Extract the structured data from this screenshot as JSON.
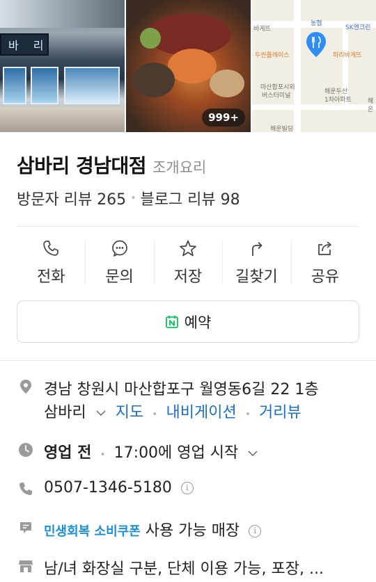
{
  "photos": {
    "count_badge": "999+",
    "storefront_sign": "바 리",
    "map_labels": {
      "l1": "바게뜨",
      "l2": "농협",
      "l3": "SK엔크린",
      "l4": "두씬플레이스",
      "l5": "파리바게뜨",
      "l6": "마산합포시외",
      "l7": "버스터미널",
      "l8": "해운두산",
      "l9": "1차아파트",
      "l10": "해운빌딩",
      "l11": "해",
      "l12": "온"
    }
  },
  "place": {
    "name": "삼바리 경남대점",
    "category": "조개요리",
    "visitor_reviews": "방문자 리뷰 265",
    "blog_reviews": "블로그 리뷰 98"
  },
  "actions": [
    {
      "label": "전화",
      "icon": "phone-icon"
    },
    {
      "label": "문의",
      "icon": "chat-icon"
    },
    {
      "label": "저장",
      "icon": "star-icon"
    },
    {
      "label": "길찾기",
      "icon": "directions-icon"
    },
    {
      "label": "공유",
      "icon": "share-icon"
    }
  ],
  "reserve": {
    "label": "예약",
    "icon": "naver-booking-icon",
    "icon_letter": "N"
  },
  "info": {
    "address_line1": "경남 창원시 마산합포구 월영동6길 22 1층",
    "address_line2": "삼바리",
    "map_link": "지도",
    "navi_link": "내비게이션",
    "street_link": "거리뷰",
    "hours_status": "영업 전",
    "hours_detail": "17:00에 영업 시작",
    "phone": "0507-1346-5180",
    "info_mark": "i",
    "coupon_link": "민생회복 소비쿠폰",
    "coupon_text": "사용 가능 매장",
    "amenities": "남/녀 화장실 구분, 단체 이용 가능, 포장, ..."
  },
  "colors": {
    "link": "#1a6fc8",
    "naver_green": "#03c75a",
    "map_pin": "#2f8df5"
  }
}
